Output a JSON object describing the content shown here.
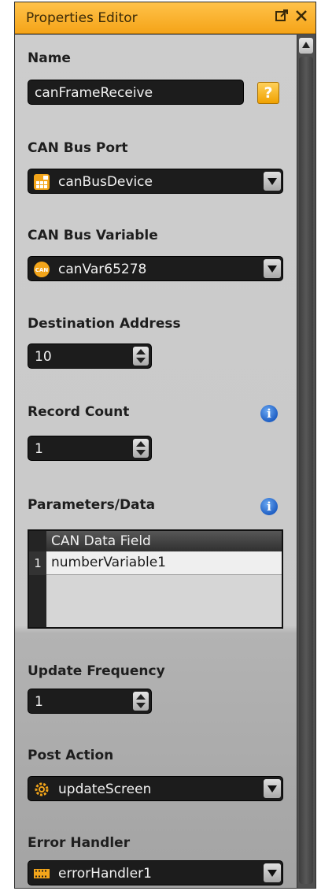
{
  "panel": {
    "title": "Properties Editor",
    "popout_icon": "popout-icon",
    "close_icon": "close-icon"
  },
  "fields": {
    "name": {
      "label": "Name",
      "value": "canFrameReceive",
      "help": "?"
    },
    "can_bus_port": {
      "label": "CAN Bus Port",
      "value": "canBusDevice",
      "icon": "can-device-icon"
    },
    "can_bus_variable": {
      "label": "CAN Bus Variable",
      "value": "canVar65278",
      "icon": "can-variable-icon",
      "icon_text": "CAN"
    },
    "destination_address": {
      "label": "Destination Address",
      "value": "10"
    },
    "record_count": {
      "label": "Record Count",
      "value": "1",
      "info": "i"
    },
    "parameters": {
      "label": "Parameters/Data",
      "info": "i",
      "columns": [
        "CAN Data Field"
      ],
      "rows": [
        {
          "num": "1",
          "value": "numberVariable1"
        }
      ]
    },
    "update_frequency": {
      "label": "Update Frequency",
      "value": "1"
    },
    "post_action": {
      "label": "Post Action",
      "value": "updateScreen",
      "icon": "gear-icon"
    },
    "error_handler": {
      "label": "Error Handler",
      "value": "errorHandler1",
      "icon": "film-strip-icon"
    }
  },
  "colors": {
    "accent": "#f5a418",
    "field_bg": "#1c1c1c",
    "panel_bg": "#cdcdcd"
  }
}
